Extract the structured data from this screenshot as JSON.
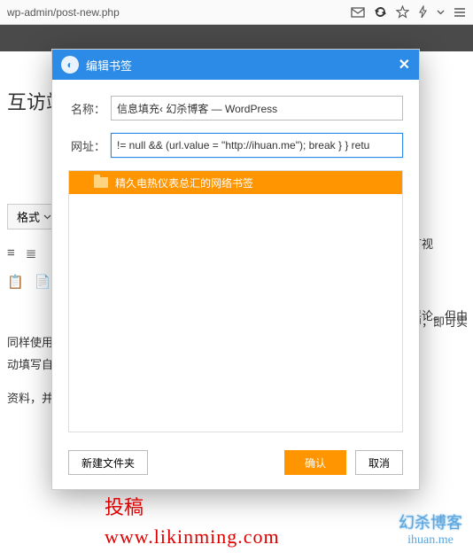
{
  "browser": {
    "url": "wp-admin/post-new.php"
  },
  "page": {
    "title": "互访站",
    "format_btn": "格式",
    "paras": [
      "同样使用 V",
      "动填写自动",
      "资料，并担"
    ],
    "right": [
      "可视",
      "评论。但由",
      "中，即可实"
    ]
  },
  "modal": {
    "title": "编辑书签",
    "name_label": "名称：",
    "name_value": "信息填充‹ 幻杀博客 — WordPress",
    "url_label": "网址：",
    "url_value": "!= null && (url.value = \"http://ihuan.me\"); break } } retu",
    "folder": "精久电热仪表总汇的网络书签",
    "new_folder": "新建文件夹",
    "ok": "确认",
    "cancel": "取消"
  },
  "watermark1": {
    "l1": "投稿",
    "l2": "www.likinming.com"
  },
  "watermark2": {
    "l1": "幻杀博客",
    "l2": "ihuan.me"
  }
}
